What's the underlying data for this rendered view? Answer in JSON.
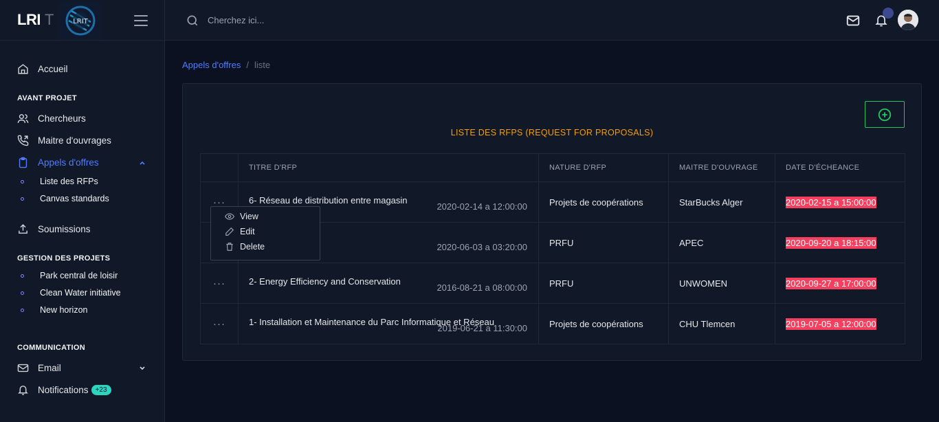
{
  "brand": {
    "name": "LRI",
    "suffix": "T"
  },
  "topbar": {
    "search_placeholder": "Cherchez ici..."
  },
  "sidebar": {
    "home": "Accueil",
    "section_avant": "AVANT PROJET",
    "chercheurs": "Chercheurs",
    "maitres": "Maitre d'ouvrages",
    "appels": "Appels d'offres",
    "sub_appels": [
      "Liste des RFPs",
      "Canvas standards"
    ],
    "soumissions": "Soumissions",
    "section_gestion": "GESTION DES PROJETS",
    "projets": [
      "Park central de loisir",
      "Clean Water initiative",
      "New horizon"
    ],
    "section_comm": "COMMUNICATION",
    "email": "Email",
    "notifications": "Notifications",
    "notif_badge": "+23"
  },
  "breadcrumb": {
    "parent": "Appels d'offres",
    "separator": "/",
    "current": "liste"
  },
  "card": {
    "title": "LISTE DES RFPS (REQUEST FOR PROPOSALS)"
  },
  "table": {
    "headers": [
      "TITRE D'RFP",
      "NATURE D'RFP",
      "MAITRE D'OUVRAGE",
      "DATE D'ÉCHEANCE"
    ],
    "rows": [
      {
        "title": "6- Réseau de distribution entre magasin",
        "created": "2020-02-14 a 12:00:00",
        "nature": "Projets de coopérations",
        "maitre": "StarBucks Alger",
        "deadline": "2020-02-15 a 15:00:00"
      },
      {
        "title": "",
        "created": "2020-06-03 a 03:20:00",
        "nature": "PRFU",
        "maitre": "APEC",
        "deadline": "2020-09-20 a 18:15:00"
      },
      {
        "title": "2- Energy Efficiency and Conservation",
        "created": "2016-08-21 a 08:00:00",
        "nature": "PRFU",
        "maitre": "UNWOMEN",
        "deadline": "2020-09-27 a 17:00:00"
      },
      {
        "title": "1- Installation et Maintenance du Parc Informatique et Réseau",
        "created": "2019-06-21 a 11:30:00",
        "nature": "Projets de coopérations",
        "maitre": "CHU Tlemcen",
        "deadline": "2019-07-05 a 12:00:00"
      }
    ],
    "dots": "···"
  },
  "dropdown": {
    "view": "View",
    "edit": "Edit",
    "delete": "Delete"
  },
  "colors": {
    "accent": "#4f7cff",
    "title": "#f59e0b",
    "deadline": "#f43f5e",
    "add": "#22c55e"
  }
}
